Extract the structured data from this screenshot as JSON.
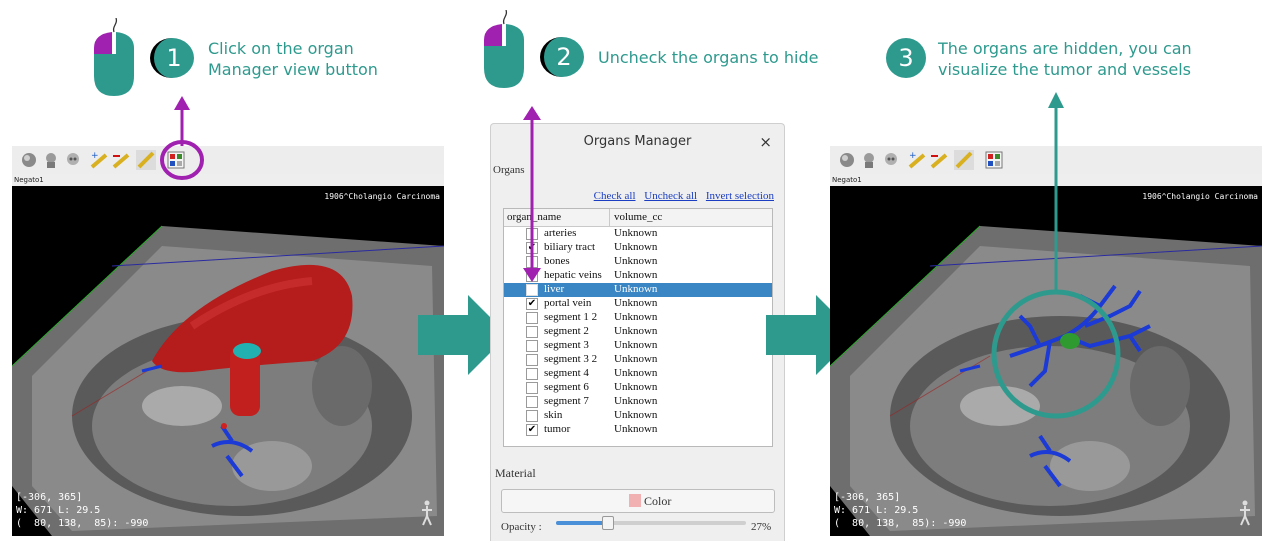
{
  "colors": {
    "teal": "#2e9a8e",
    "purple": "#a020b0",
    "selection": "#3a86c4"
  },
  "steps": [
    {
      "number": "1",
      "line1": "Click on the organ",
      "line2": "Manager view button",
      "icon": "mouse-click-icon"
    },
    {
      "number": "2",
      "line1": "Uncheck the organs to hide",
      "line2": "",
      "icon": "mouse-click-icon"
    },
    {
      "number": "3",
      "line1": "The organs are hidden, you can",
      "line2": "visualize the tumor and vessels",
      "icon": ""
    }
  ],
  "viewer_left": {
    "tab_label": "Negato1",
    "study": "1906^Cholangio Carcinoma",
    "coords": "[-306, 365]\nW: 671 L: 29.5\n(  80, 138,  85): -990"
  },
  "viewer_right": {
    "tab_label": "Negato1",
    "study": "1906^Cholangio Carcinoma",
    "coords": "[-306, 365]\nW: 671 L: 29.5\n(  80, 138,  85): -990"
  },
  "dialog": {
    "title": "Organs Manager",
    "close": "×",
    "group": "Organs",
    "links": {
      "check_all": "Check all",
      "uncheck_all": "Uncheck all",
      "invert": "Invert selection"
    },
    "headers": {
      "name": "organ_name",
      "volume": "volume_cc"
    },
    "organs": [
      {
        "name": "arteries",
        "volume": "Unknown",
        "checked": false,
        "selected": false
      },
      {
        "name": "biliary tract",
        "volume": "Unknown",
        "checked": true,
        "selected": false
      },
      {
        "name": "bones",
        "volume": "Unknown",
        "checked": false,
        "selected": false
      },
      {
        "name": "hepatic veins",
        "volume": "Unknown",
        "checked": true,
        "selected": false
      },
      {
        "name": "liver",
        "volume": "Unknown",
        "checked": false,
        "selected": true
      },
      {
        "name": "portal vein",
        "volume": "Unknown",
        "checked": true,
        "selected": false
      },
      {
        "name": "segment 1 2",
        "volume": "Unknown",
        "checked": false,
        "selected": false
      },
      {
        "name": "segment 2",
        "volume": "Unknown",
        "checked": false,
        "selected": false
      },
      {
        "name": "segment 3",
        "volume": "Unknown",
        "checked": false,
        "selected": false
      },
      {
        "name": "segment 3 2",
        "volume": "Unknown",
        "checked": false,
        "selected": false
      },
      {
        "name": "segment 4",
        "volume": "Unknown",
        "checked": false,
        "selected": false
      },
      {
        "name": "segment 6",
        "volume": "Unknown",
        "checked": false,
        "selected": false
      },
      {
        "name": "segment 7",
        "volume": "Unknown",
        "checked": false,
        "selected": false
      },
      {
        "name": "skin",
        "volume": "Unknown",
        "checked": false,
        "selected": false
      },
      {
        "name": "tumor",
        "volume": "Unknown",
        "checked": true,
        "selected": false
      }
    ],
    "material": "Material",
    "color_button": "Color",
    "swatch_color": "#f1b1b3",
    "opacity_label": "Opacity :",
    "opacity_value": "27%",
    "opacity_fraction": 0.27
  }
}
